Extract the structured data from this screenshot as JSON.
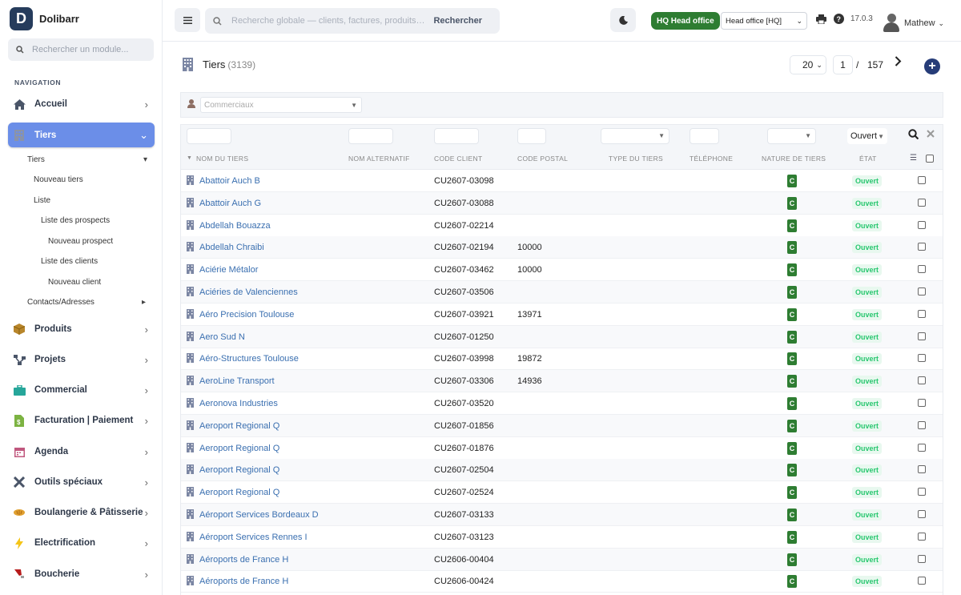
{
  "app": {
    "name": "Dolibarr",
    "logo_letter": "D"
  },
  "sidebar": {
    "search_placeholder": "Rechercher un module...",
    "nav_heading": "NAVIGATION",
    "items": [
      {
        "label": "Accueil",
        "icon": "home-icon"
      },
      {
        "label": "Tiers",
        "icon": "building-icon"
      },
      {
        "label": "Produits",
        "icon": "box-icon"
      },
      {
        "label": "Projets",
        "icon": "project-icon"
      },
      {
        "label": "Commercial",
        "icon": "briefcase-icon"
      },
      {
        "label": "Facturation | Paiement",
        "icon": "invoice-icon"
      },
      {
        "label": "Agenda",
        "icon": "calendar-icon"
      },
      {
        "label": "Outils spéciaux",
        "icon": "tools-icon"
      },
      {
        "label": "Boulangerie & Pâtisserie",
        "icon": "bread-icon"
      },
      {
        "label": "Electrification",
        "icon": "lightning-icon"
      },
      {
        "label": "Boucherie",
        "icon": "meat-icon"
      }
    ],
    "sub_items": [
      {
        "label": "Tiers"
      },
      {
        "label": "Nouveau tiers"
      },
      {
        "label": "Liste"
      },
      {
        "label": "Liste des prospects"
      },
      {
        "label": "Nouveau prospect"
      },
      {
        "label": "Liste des clients"
      },
      {
        "label": "Nouveau client"
      },
      {
        "label": "Contacts/Adresses"
      }
    ]
  },
  "topbar": {
    "search_placeholder": "Recherche globale — clients, factures, produits…",
    "search_button": "Rechercher",
    "hq_badge": "HQ  Head office",
    "entity": "Head office [HQ]",
    "version": "17.0.3",
    "user": "Mathew"
  },
  "page": {
    "title": "Tiers",
    "count": "(3139)",
    "per_page": "20",
    "page": "1",
    "page_sep": "/",
    "total_pages": "157"
  },
  "filters": {
    "commerciaux_placeholder": "Commerciaux",
    "etat_value": "Ouvert"
  },
  "columns": {
    "name": "NOM DU TIERS",
    "alt": "NOM ALTERNATIF",
    "client_code": "CODE CLIENT",
    "postal": "CODE POSTAL",
    "type": "TYPE DU TIERS",
    "phone": "TÉLÉPHONE",
    "nature": "NATURE DE TIERS",
    "state": "ÉTAT"
  },
  "rows": [
    {
      "name": "Abattoir Auch B",
      "code": "CU2607-03098",
      "cp": "",
      "nature": "C",
      "etat": "Ouvert"
    },
    {
      "name": "Abattoir Auch G",
      "code": "CU2607-03088",
      "cp": "",
      "nature": "C",
      "etat": "Ouvert"
    },
    {
      "name": "Abdellah Bouazza",
      "code": "CU2607-02214",
      "cp": "",
      "nature": "C",
      "etat": "Ouvert"
    },
    {
      "name": "Abdellah Chraibi",
      "code": "CU2607-02194",
      "cp": "10000",
      "nature": "C",
      "etat": "Ouvert"
    },
    {
      "name": "Aciérie Métalor",
      "code": "CU2607-03462",
      "cp": "10000",
      "nature": "C",
      "etat": "Ouvert"
    },
    {
      "name": "Aciéries de Valenciennes",
      "code": "CU2607-03506",
      "cp": "",
      "nature": "C",
      "etat": "Ouvert"
    },
    {
      "name": "Aéro Precision Toulouse",
      "code": "CU2607-03921",
      "cp": "13971",
      "nature": "C",
      "etat": "Ouvert"
    },
    {
      "name": "Aero Sud N",
      "code": "CU2607-01250",
      "cp": "",
      "nature": "C",
      "etat": "Ouvert"
    },
    {
      "name": "Aéro-Structures Toulouse",
      "code": "CU2607-03998",
      "cp": "19872",
      "nature": "C",
      "etat": "Ouvert"
    },
    {
      "name": "AeroLine Transport",
      "code": "CU2607-03306",
      "cp": "14936",
      "nature": "C",
      "etat": "Ouvert"
    },
    {
      "name": "Aeronova Industries",
      "code": "CU2607-03520",
      "cp": "",
      "nature": "C",
      "etat": "Ouvert"
    },
    {
      "name": "Aeroport Regional Q",
      "code": "CU2607-01856",
      "cp": "",
      "nature": "C",
      "etat": "Ouvert"
    },
    {
      "name": "Aeroport Regional Q",
      "code": "CU2607-01876",
      "cp": "",
      "nature": "C",
      "etat": "Ouvert"
    },
    {
      "name": "Aeroport Regional Q",
      "code": "CU2607-02504",
      "cp": "",
      "nature": "C",
      "etat": "Ouvert"
    },
    {
      "name": "Aeroport Regional Q",
      "code": "CU2607-02524",
      "cp": "",
      "nature": "C",
      "etat": "Ouvert"
    },
    {
      "name": "Aéroport Services Bordeaux D",
      "code": "CU2607-03133",
      "cp": "",
      "nature": "C",
      "etat": "Ouvert"
    },
    {
      "name": "Aéroport Services Rennes I",
      "code": "CU2607-03123",
      "cp": "",
      "nature": "C",
      "etat": "Ouvert"
    },
    {
      "name": "Aéroports de France H",
      "code": "CU2606-00404",
      "cp": "",
      "nature": "C",
      "etat": "Ouvert"
    },
    {
      "name": "Aéroports de France H",
      "code": "CU2606-00424",
      "cp": "",
      "nature": "C",
      "etat": "Ouvert"
    }
  ],
  "colors": {
    "accent": "#6b8ee8",
    "link": "#3a6fb0",
    "status_green": "#28c76f",
    "nature_green": "#2e7d32"
  }
}
